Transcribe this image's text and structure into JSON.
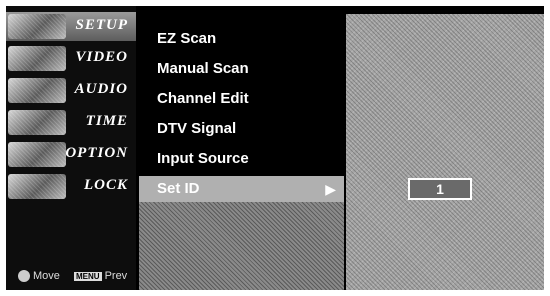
{
  "categories": [
    {
      "label": "SETUP",
      "icon": "setup-icon"
    },
    {
      "label": "VIDEO",
      "icon": "video-icon"
    },
    {
      "label": "AUDIO",
      "icon": "audio-icon"
    },
    {
      "label": "TIME",
      "icon": "time-icon"
    },
    {
      "label": "OPTION",
      "icon": "option-icon"
    },
    {
      "label": "LOCK",
      "icon": "lock-icon"
    }
  ],
  "active_category": "SETUP",
  "hints": {
    "move_label": "Move",
    "prev_key": "MENU",
    "prev_label": "Prev"
  },
  "menu": {
    "items": [
      {
        "label": "EZ Scan"
      },
      {
        "label": "Manual Scan"
      },
      {
        "label": "Channel Edit"
      },
      {
        "label": "DTV Signal"
      },
      {
        "label": "Input Source"
      },
      {
        "label": "Set ID",
        "selected": true
      }
    ],
    "submenu_arrow": "▶"
  },
  "set_id": {
    "value": "1"
  },
  "colors": {
    "background": "#000000",
    "selected_bar": "#b0b0b0",
    "panel": "#a6a6a6"
  }
}
